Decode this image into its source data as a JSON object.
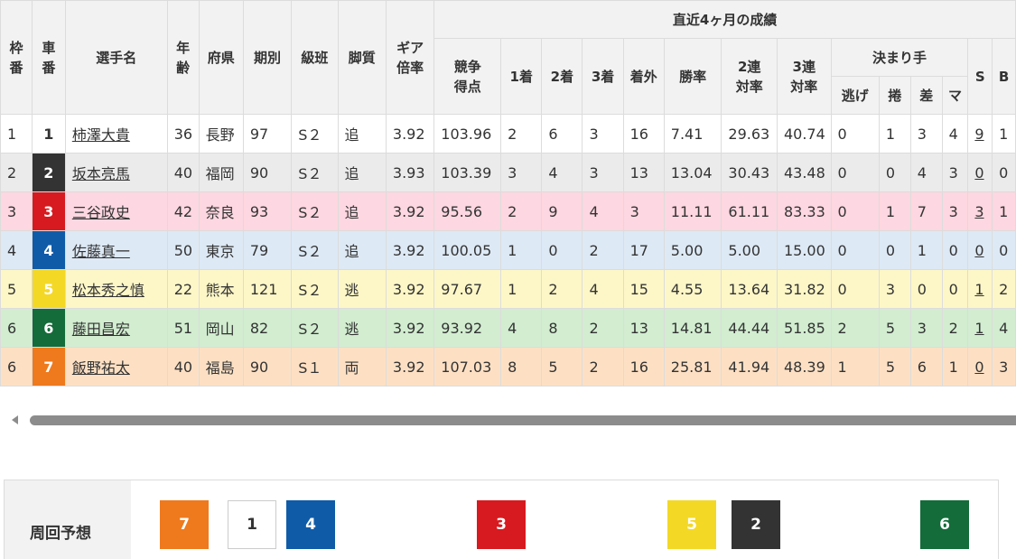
{
  "headers": {
    "frame": "枠\n番",
    "car": "車\n番",
    "name": "選手名",
    "age": "年\n齢",
    "pref": "府県",
    "term": "期別",
    "class": "級班",
    "style": "脚質",
    "gear": "ギア\n倍率",
    "recent": "直近4ヶ月の成績",
    "score": "競争\n得点",
    "first": "1着",
    "second": "2着",
    "third": "3着",
    "outside": "着外",
    "win_rate": "勝率",
    "quinella": "2連\n対率",
    "trifecta": "3連\n対率",
    "kimarite": "決まり手",
    "nige": "逃げ",
    "makuri": "捲",
    "sashi": "差",
    "mark": "マ",
    "s": "S",
    "b": "B"
  },
  "colors": {
    "car1": "#ffffff",
    "car2": "#333333",
    "car3": "#d71a1f",
    "car4": "#0f5ba8",
    "car5": "#f3d826",
    "car6": "#136c39",
    "car7": "#ee7a1d",
    "row1": "#ffffff",
    "row2": "#ebebeb",
    "row3": "#fdd7e1",
    "row4": "#dde9f5",
    "row5": "#fdf7c7",
    "row6": "#d2edd0",
    "row7": "#fde0c4"
  },
  "riders": [
    {
      "frame": "1",
      "car": "1",
      "name": "柿澤大貴",
      "age": "36",
      "pref": "長野",
      "term": "97",
      "class": "S２",
      "style": "追",
      "gear": "3.92",
      "score": "103.96",
      "first": "2",
      "second": "6",
      "third": "3",
      "outside": "16",
      "win_rate": "7.41",
      "quinella": "29.63",
      "trifecta": "40.74",
      "nige": "0",
      "makuri": "1",
      "sashi": "3",
      "mark": "4",
      "s": "9",
      "b": "1"
    },
    {
      "frame": "2",
      "car": "2",
      "name": "坂本亮馬",
      "age": "40",
      "pref": "福岡",
      "term": "90",
      "class": "S２",
      "style": "追",
      "gear": "3.93",
      "score": "103.39",
      "first": "3",
      "second": "4",
      "third": "3",
      "outside": "13",
      "win_rate": "13.04",
      "quinella": "30.43",
      "trifecta": "43.48",
      "nige": "0",
      "makuri": "0",
      "sashi": "4",
      "mark": "3",
      "s": "0",
      "b": "0"
    },
    {
      "frame": "3",
      "car": "3",
      "name": "三谷政史",
      "age": "42",
      "pref": "奈良",
      "term": "93",
      "class": "S２",
      "style": "追",
      "gear": "3.92",
      "score": "95.56",
      "first": "2",
      "second": "9",
      "third": "4",
      "outside": "3",
      "win_rate": "11.11",
      "quinella": "61.11",
      "trifecta": "83.33",
      "nige": "0",
      "makuri": "1",
      "sashi": "7",
      "mark": "3",
      "s": "3",
      "b": "1"
    },
    {
      "frame": "4",
      "car": "4",
      "name": "佐藤真一",
      "age": "50",
      "pref": "東京",
      "term": "79",
      "class": "S２",
      "style": "追",
      "gear": "3.92",
      "score": "100.05",
      "first": "1",
      "second": "0",
      "third": "2",
      "outside": "17",
      "win_rate": "5.00",
      "quinella": "5.00",
      "trifecta": "15.00",
      "nige": "0",
      "makuri": "0",
      "sashi": "1",
      "mark": "0",
      "s": "0",
      "b": "0"
    },
    {
      "frame": "5",
      "car": "5",
      "name": "松本秀之慎",
      "age": "22",
      "pref": "熊本",
      "term": "121",
      "class": "S２",
      "style": "逃",
      "gear": "3.92",
      "score": "97.67",
      "first": "1",
      "second": "2",
      "third": "4",
      "outside": "15",
      "win_rate": "4.55",
      "quinella": "13.64",
      "trifecta": "31.82",
      "nige": "0",
      "makuri": "3",
      "sashi": "0",
      "mark": "0",
      "s": "1",
      "b": "2"
    },
    {
      "frame": "6",
      "car": "6",
      "name": "藤田昌宏",
      "age": "51",
      "pref": "岡山",
      "term": "82",
      "class": "S２",
      "style": "逃",
      "gear": "3.92",
      "score": "93.92",
      "first": "4",
      "second": "8",
      "third": "2",
      "outside": "13",
      "win_rate": "14.81",
      "quinella": "44.44",
      "trifecta": "51.85",
      "nige": "2",
      "makuri": "5",
      "sashi": "3",
      "mark": "2",
      "s": "1",
      "b": "4"
    },
    {
      "frame": "6",
      "car": "7",
      "name": "飯野祐太",
      "age": "40",
      "pref": "福島",
      "term": "90",
      "class": "S１",
      "style": "両",
      "gear": "3.92",
      "score": "107.03",
      "first": "8",
      "second": "5",
      "third": "2",
      "outside": "16",
      "win_rate": "25.81",
      "quinella": "41.94",
      "trifecta": "48.39",
      "nige": "1",
      "makuri": "5",
      "sashi": "6",
      "mark": "1",
      "s": "0",
      "b": "3"
    }
  ],
  "forecast": {
    "label": "周回予想",
    "cars": [
      "7",
      "1",
      "4",
      "3",
      "5",
      "2",
      "6"
    ]
  }
}
